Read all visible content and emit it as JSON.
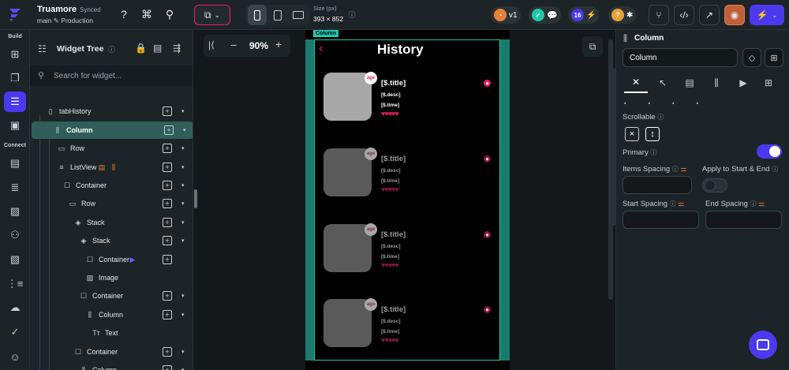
{
  "topbar": {
    "project_name": "Truamore",
    "sync_status": "Synced",
    "branch": "main",
    "environment": "Production",
    "size_label": "Size (px)",
    "size_value": "393 × 852",
    "version": "v1",
    "notification_count": "16",
    "warning_count": "7"
  },
  "rail": {
    "build_label": "Build",
    "connect_label": "Connect"
  },
  "tree": {
    "title": "Widget Tree",
    "search_placeholder": "Search for widget...",
    "items": [
      {
        "label": "tabHistory",
        "icon": "phone"
      },
      {
        "label": "Column",
        "icon": "column"
      },
      {
        "label": "Row",
        "icon": "row"
      },
      {
        "label": "ListView",
        "icon": "list"
      },
      {
        "label": "Container",
        "icon": "container"
      },
      {
        "label": "Row",
        "icon": "row"
      },
      {
        "label": "Stack",
        "icon": "stack"
      },
      {
        "label": "Stack",
        "icon": "stack"
      },
      {
        "label": "Container",
        "icon": "container"
      },
      {
        "label": "Image",
        "icon": "image"
      },
      {
        "label": "Container",
        "icon": "container"
      },
      {
        "label": "Column",
        "icon": "column"
      },
      {
        "label": "Text",
        "icon": "text"
      },
      {
        "label": "Container",
        "icon": "container"
      },
      {
        "label": "Column",
        "icon": "column"
      }
    ]
  },
  "canvas": {
    "zoom": "90%",
    "column_tag": "Column",
    "screen_title": "History",
    "cards": [
      {
        "title": "[$.title]",
        "desc": "[$.desc]",
        "time": "[$.time]",
        "badge": "age",
        "bright": true
      },
      {
        "title": "[$.title]",
        "desc": "[$.desc]",
        "time": "[$.time]",
        "badge": "age",
        "bright": false
      },
      {
        "title": "[$.title]",
        "desc": "[$.desc]",
        "time": "[$.time]",
        "badge": "age",
        "bright": false
      },
      {
        "title": "[$.title]",
        "desc": "[$.desc]",
        "time": "[$.time]",
        "badge": "age",
        "bright": false
      }
    ],
    "hearts": "♥♥♥♥♥"
  },
  "panel": {
    "widget_type": "Column",
    "name_value": "Column",
    "scrollable_label": "Scrollable",
    "primary_label": "Primary",
    "primary_on": true,
    "items_spacing_label": "Items Spacing",
    "apply_label": "Apply to Start & End",
    "start_spacing_label": "Start Spacing",
    "end_spacing_label": "End Spacing"
  },
  "colors": {
    "accent": "#4b39ef",
    "selected_row": "#2f5f58",
    "brand_pink": "#e91e63",
    "teal": "#22c7a9"
  }
}
